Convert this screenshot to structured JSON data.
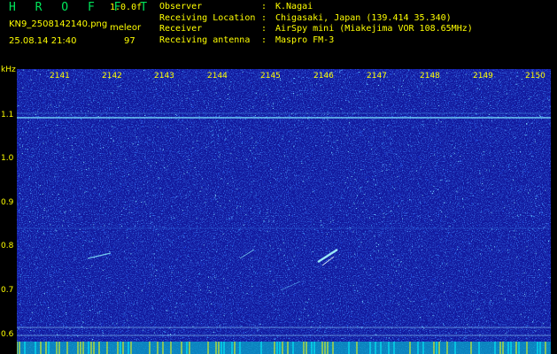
{
  "header": {
    "brand": "H R O F F T",
    "version": "1.0.0f",
    "filename": "KN9_2508142140.png",
    "site": "meleor",
    "datetime": "25.08.14 21:40",
    "count": "97"
  },
  "info": [
    {
      "key": "Observer",
      "value": "K.Nagai"
    },
    {
      "key": "Receiving Location",
      "value": "Chigasaki, Japan (139.414 35.340)"
    },
    {
      "key": "Receiver",
      "value": "AirSpy mini (Miakejima VOR 108.65MHz)"
    },
    {
      "key": "Receiving antenna",
      "value": "Maspro FM-3"
    }
  ],
  "info_sep": ":",
  "axis": {
    "unit": "kHz",
    "y_ticks": [
      "1.1",
      "1.0",
      "0.9",
      "0.8",
      "0.7",
      "0.6"
    ],
    "x_ticks": [
      "2141",
      "2142",
      "2143",
      "2144",
      "2145",
      "2146",
      "2147",
      "2148",
      "2149",
      "2150"
    ]
  },
  "colors": {
    "background": "#000000",
    "spectrum_base": "#12199e",
    "signal": "#7fe8ff",
    "text": "#ffff00",
    "brand": "#00e65a"
  }
}
